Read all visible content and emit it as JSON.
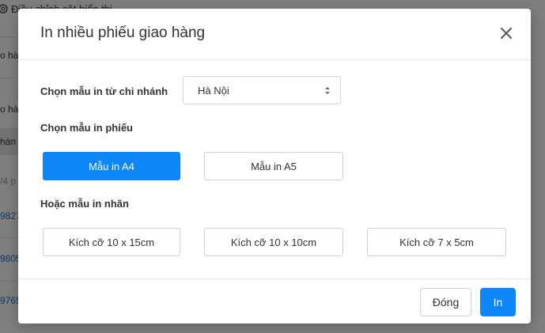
{
  "background": {
    "top_label": "Điều chỉnh cột hiển thị",
    "rows": [
      "o hà",
      "o hà",
      "hàn",
      "/4 p",
      "9827",
      "9805",
      "9765"
    ]
  },
  "modal": {
    "title": "In nhiều phiếu giao hàng",
    "branch_label": "Chọn mẫu in từ chi nhánh",
    "branch_value": "Hà Nội",
    "template_label": "Chọn mẫu in phiếu",
    "templates": [
      "Mẫu in A4",
      "Mẫu in A5"
    ],
    "selected_template": "Mẫu in A4",
    "label_section": "Hoặc mẫu in nhãn",
    "label_sizes": [
      "Kích cỡ 10 x 15cm",
      "Kích cỡ 10 x 10cm",
      "Kích cỡ 7 x 5cm"
    ],
    "close_button": "Đóng",
    "print_button": "In"
  },
  "colors": {
    "primary": "#0d86f7",
    "overlay": "rgba(0,0,0,0.5)"
  }
}
